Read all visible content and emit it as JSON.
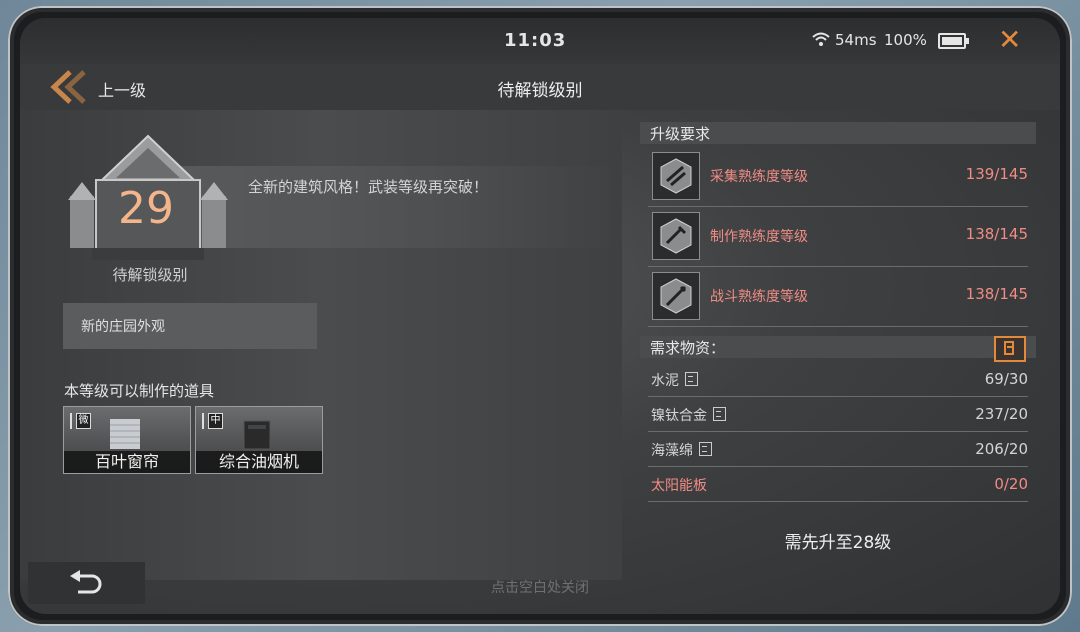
{
  "status": {
    "time": "11:03",
    "network": "54ms",
    "battery": "100%",
    "battery_level": 1.0
  },
  "header": {
    "back_label": "上一级",
    "title": "待解锁级别"
  },
  "level": {
    "number": "29",
    "label": "待解锁级别",
    "description": "全新的建筑风格！武装等级再突破！",
    "feature": "新的庄园外观"
  },
  "craft": {
    "title": "本等级可以制作的道具",
    "items": [
      {
        "tag": "微",
        "name": "百叶窗帘"
      },
      {
        "tag": "中",
        "name": "综合油烟机"
      }
    ]
  },
  "requirements": {
    "title": "升级要求",
    "items": [
      {
        "name": "采集熟练度等级",
        "value": "139/145"
      },
      {
        "name": "制作熟练度等级",
        "value": "138/145"
      },
      {
        "name": "战斗熟练度等级",
        "value": "138/145"
      }
    ]
  },
  "materials": {
    "title": "需求物资：",
    "items": [
      {
        "name": "水泥",
        "value": "69/30"
      },
      {
        "name": "镍钛合金",
        "value": "237/20"
      },
      {
        "name": "海藻绵",
        "value": "206/20"
      },
      {
        "name": "太阳能板",
        "value": "0/20"
      }
    ]
  },
  "footer_note": "需先升至28级",
  "hint": "点击空白处关闭",
  "colors": {
    "accent": "#e2893c",
    "warning": "#f08c84",
    "level": "#f2b58c"
  }
}
